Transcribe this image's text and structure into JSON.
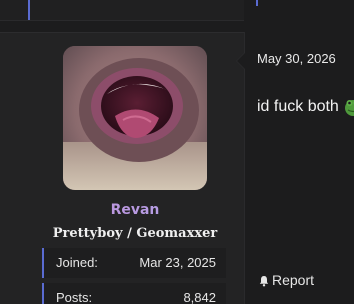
{
  "user": {
    "username": "Revan",
    "title": "Prettyboy / Geomaxxer",
    "stats": [
      {
        "label": "Joined:",
        "value": "Mar 23, 2025"
      },
      {
        "label": "Posts:",
        "value": "8,842"
      }
    ]
  },
  "post": {
    "date": "May 30, 2026",
    "text": "id fuck both",
    "emoji_icon": "frog-emoji-icon",
    "report_label": "Report",
    "report_icon": "bell-icon"
  },
  "colors": {
    "accent": "#5a6bd1",
    "username_gradient_start": "#c98ad6",
    "username_gradient_end": "#9fb4ee",
    "background": "#1c1c1d",
    "user_panel": "#232324"
  }
}
